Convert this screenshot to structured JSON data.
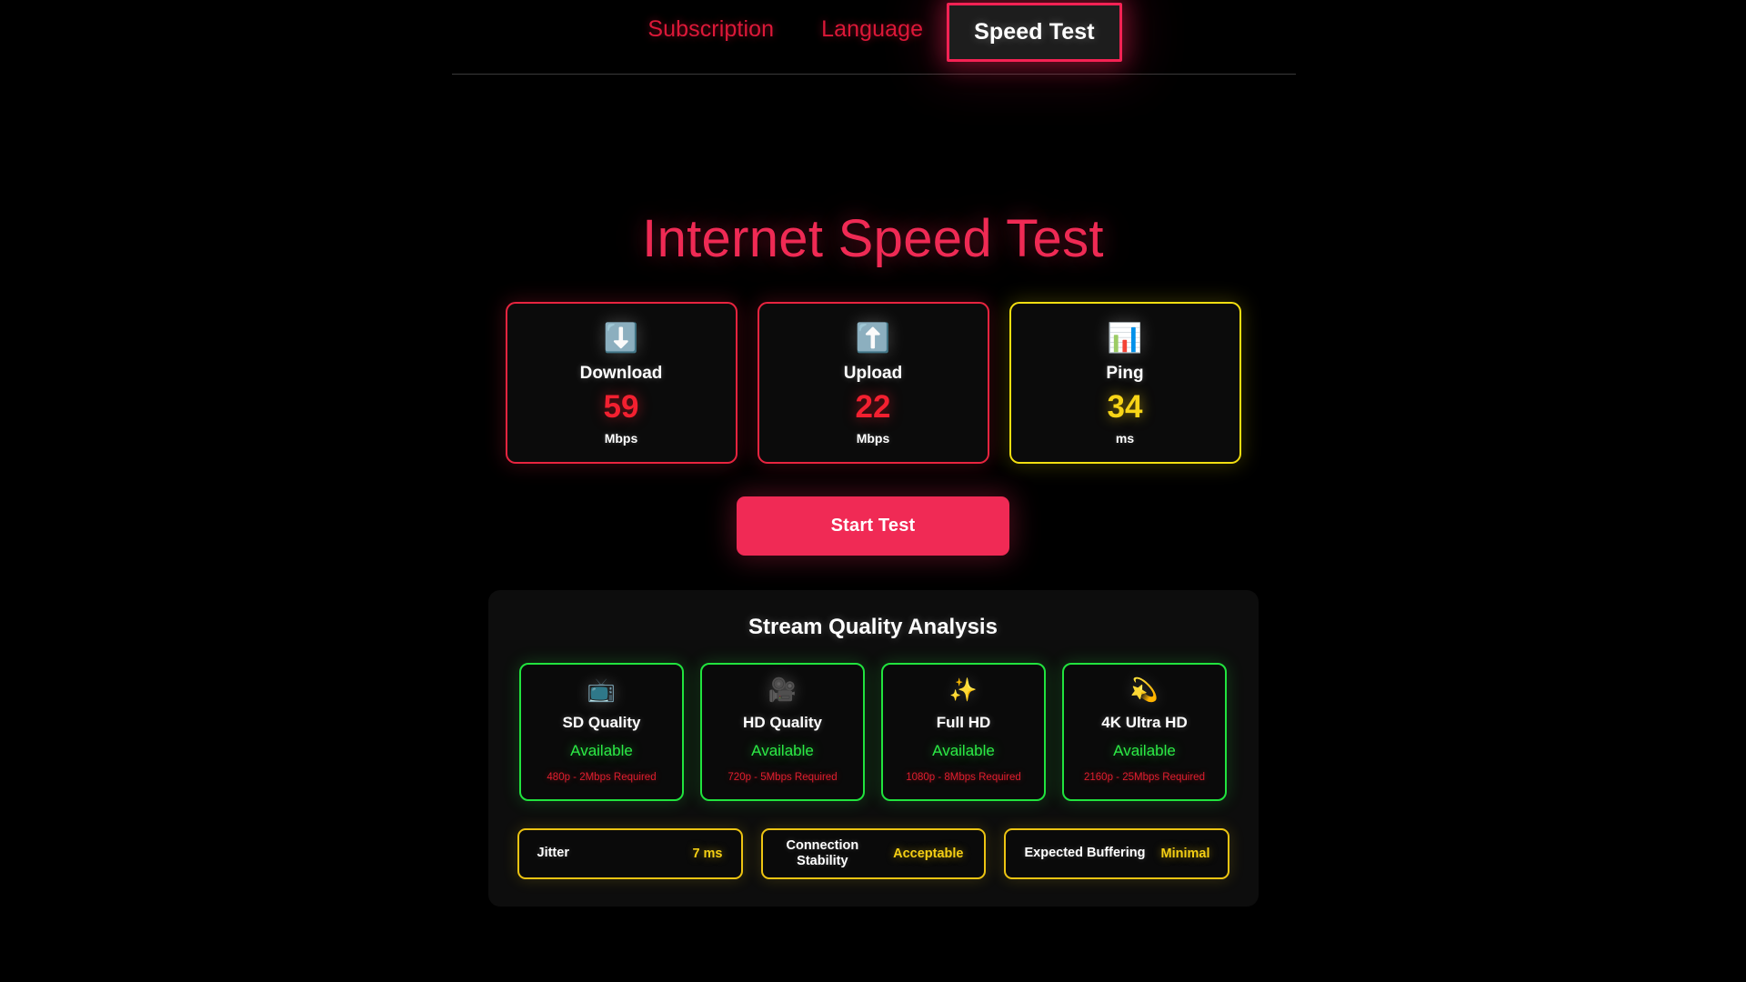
{
  "nav": {
    "tabs": [
      {
        "label": "Subscription",
        "active": false
      },
      {
        "label": "Language",
        "active": false
      },
      {
        "label": "Speed Test",
        "active": true
      }
    ]
  },
  "page": {
    "title": "Internet Speed Test"
  },
  "metrics": [
    {
      "icon": "⬇️",
      "icon_name": "download-arrow-icon",
      "label": "Download",
      "value": "59",
      "unit": "Mbps",
      "accent": "#e8243f"
    },
    {
      "icon": "⬆️",
      "icon_name": "upload-arrow-icon",
      "label": "Upload",
      "value": "22",
      "unit": "Mbps",
      "accent": "#e8243f"
    },
    {
      "icon": "📊",
      "icon_name": "bar-chart-icon",
      "label": "Ping",
      "value": "34",
      "unit": "ms",
      "accent": "#f2de10"
    }
  ],
  "actions": {
    "start_test_label": "Start Test"
  },
  "analysis": {
    "title": "Stream Quality Analysis",
    "qualities": [
      {
        "icon": "📺",
        "icon_name": "television-icon",
        "name": "SD Quality",
        "status": "Available",
        "requirement": "480p - 2Mbps Required"
      },
      {
        "icon": "🎥",
        "icon_name": "movie-camera-icon",
        "name": "HD Quality",
        "status": "Available",
        "requirement": "720p - 5Mbps Required"
      },
      {
        "icon": "✨",
        "icon_name": "sparkles-icon",
        "name": "Full HD",
        "status": "Available",
        "requirement": "1080p - 8Mbps Required"
      },
      {
        "icon": "💫",
        "icon_name": "dizzy-star-icon",
        "name": "4K Ultra HD",
        "status": "Available",
        "requirement": "2160p - 25Mbps Required"
      }
    ],
    "stats": [
      {
        "label": "Jitter",
        "value": "7 ms"
      },
      {
        "label_line1": "Connection",
        "label_line2": "Stability",
        "value": "Acceptable"
      },
      {
        "label": "Expected Buffering",
        "value": "Minimal"
      }
    ]
  },
  "colors": {
    "background": "#000000",
    "accent_pink": "#f02a55",
    "accent_red": "#e8243f",
    "accent_yellow": "#edc412",
    "accent_green": "#21e33e",
    "panel_background": "#0d0d0d"
  }
}
